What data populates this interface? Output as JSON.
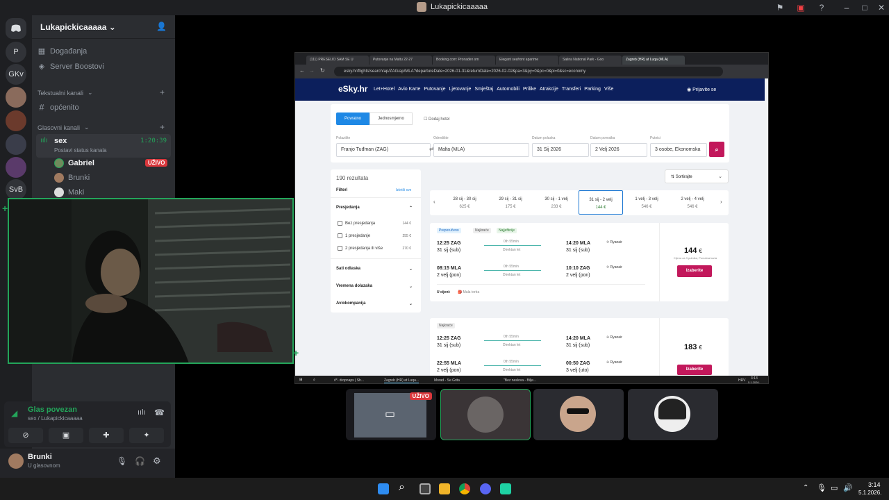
{
  "window": {
    "title": "Lukapickicaaaaa"
  },
  "servers": [
    "P",
    "GKv",
    "SvB"
  ],
  "sidebar": {
    "server_name": "Lukapickicaaaaa",
    "events": "Događanja",
    "boosts": "Server Boostovi",
    "text_category": "Tekstualni kanali",
    "text_channel": "općenito",
    "voice_category": "Glasovni kanali",
    "voice_channel": "sex",
    "voice_timer": "1:20:39",
    "status_placeholder": "Postavi status kanala",
    "members": [
      {
        "name": "Gabriel",
        "badge": "UŽIVO"
      },
      {
        "name": "Brunki"
      },
      {
        "name": "Maki"
      }
    ]
  },
  "voice_panel": {
    "status": "Glas povezan",
    "channel": "sex / Lukapickicaaaaa"
  },
  "user_panel": {
    "name": "Brunki",
    "status": "U glasovnom"
  },
  "browser": {
    "tabs": [
      "(111) PRESELIO SAM SE U",
      "Putovanje na Maltu 22-27",
      "Booking.com: Pronađen sm",
      "Elegant seafront apartme",
      "Salina National Park - Goo",
      "Zagreb (HR) at Luqa (MLA)"
    ],
    "url": "esky.hr/flights/search/ap/ZAG/ap/MLA?departureDate=2026-01-31&returnDate=2026-02-02&pa=3&py=0&pc=0&pi=0&sc=economy"
  },
  "esky": {
    "logo": "eSky.hr",
    "nav": [
      "Let+Hotel",
      "Avio Karte",
      "Putovanje",
      "Ljetovanje",
      "Smještaj",
      "Automobili",
      "Prilike",
      "Atrakcije",
      "Transferi",
      "Parking",
      "Više"
    ],
    "login": "Prijavite se",
    "trip_tabs": [
      "Povratno",
      "Jednosmjerno"
    ],
    "add_hotel": "Dodaj hotel",
    "fields": {
      "from_label": "Polazište",
      "from": "Franjo Tuđman (ZAG)",
      "to_label": "Odredište",
      "to": "Malta (MLA)",
      "dep_label": "Datum polaska",
      "dep": "31 Sij 2026",
      "ret_label": "Datum povratka",
      "ret": "2 Velj 2026",
      "pax_label": "Putnici",
      "pax": "3 osobe, Ekonomska"
    },
    "results_count": "190 rezultata",
    "filters_title": "Filteri",
    "clear_all": "Izbriši sve",
    "stops_title": "Presjedanja",
    "stops": [
      {
        "label": "Bez presjedanja",
        "price": "144 €"
      },
      {
        "label": "1 presjedanje",
        "price": "255 €"
      },
      {
        "label": "2 presjedanja ili više",
        "price": "270 €"
      }
    ],
    "sections": [
      "Sati odlaska",
      "Vremena dolazaka",
      "Aviokompanija"
    ],
    "sort": "Sortirajte",
    "dates": [
      {
        "range": "28 sij - 30 sij",
        "price": "625 €"
      },
      {
        "range": "29 sij - 31 sij",
        "price": "175 €"
      },
      {
        "range": "30 sij - 1 velj",
        "price": "233 €"
      },
      {
        "range": "31 sij - 2 velj",
        "price": "144 €"
      },
      {
        "range": "1 velj - 3 velj",
        "price": "546 €"
      },
      {
        "range": "2 velj - 4 velj",
        "price": "546 €"
      }
    ],
    "offer1": {
      "tags": [
        "Preporučeno",
        "Najkraće",
        "Najjeftinije"
      ],
      "out": {
        "dep": "12:25 ZAG",
        "dep_date": "31 sij (sub)",
        "dur": "0th 55min",
        "type": "Direktan let",
        "arr": "14:20 MLA",
        "arr_date": "31 sij (sub)",
        "airline": "Ryanair"
      },
      "back": {
        "dep": "08:15 MLA",
        "dep_date": "2 velj (pon)",
        "dur": "0th 55min",
        "type": "Direktan let",
        "arr": "10:10 ZAG",
        "arr_date": "2 velj (pon)",
        "airline": "Ryanair"
      },
      "included_label": "U cijeni:",
      "included": "Mala torba",
      "price": "144",
      "currency": "€",
      "price_note": "Cijena za 3 putnika, Povratna karta",
      "cta": "Izaberite"
    },
    "offer2": {
      "tag": "Najkraće",
      "out": {
        "dep": "12:25 ZAG",
        "dep_date": "31 sij (sub)",
        "dur": "0th 55min",
        "type": "Direktan let",
        "arr": "14:20 MLA",
        "arr_date": "31 sij (sub)",
        "airline": "Ryanair"
      },
      "back": {
        "dep": "22:55 MLA",
        "dep_date": "2 velj (pon)",
        "dur": "0th 55min",
        "type": "Direktan let",
        "arr": "00:50 ZAG",
        "arr_date": "3 velj (uto)",
        "airline": "Ryanair"
      },
      "price": "183",
      "currency": "€",
      "cta": "Izaberite"
    },
    "taskbar": {
      "items": [
        "#*- dropnaps | Sh...",
        "Zagreb (HR) at Luqa...",
        "Morad - Se Grita",
        "\"Bez naslova - Bilje..."
      ],
      "time": "3:13",
      "date": "5.1.2026.",
      "lang": "HRV"
    }
  },
  "call": {
    "live_badge": "UŽIVO"
  },
  "os_taskbar": {
    "time": "3:14",
    "date": "5.1.2026."
  }
}
